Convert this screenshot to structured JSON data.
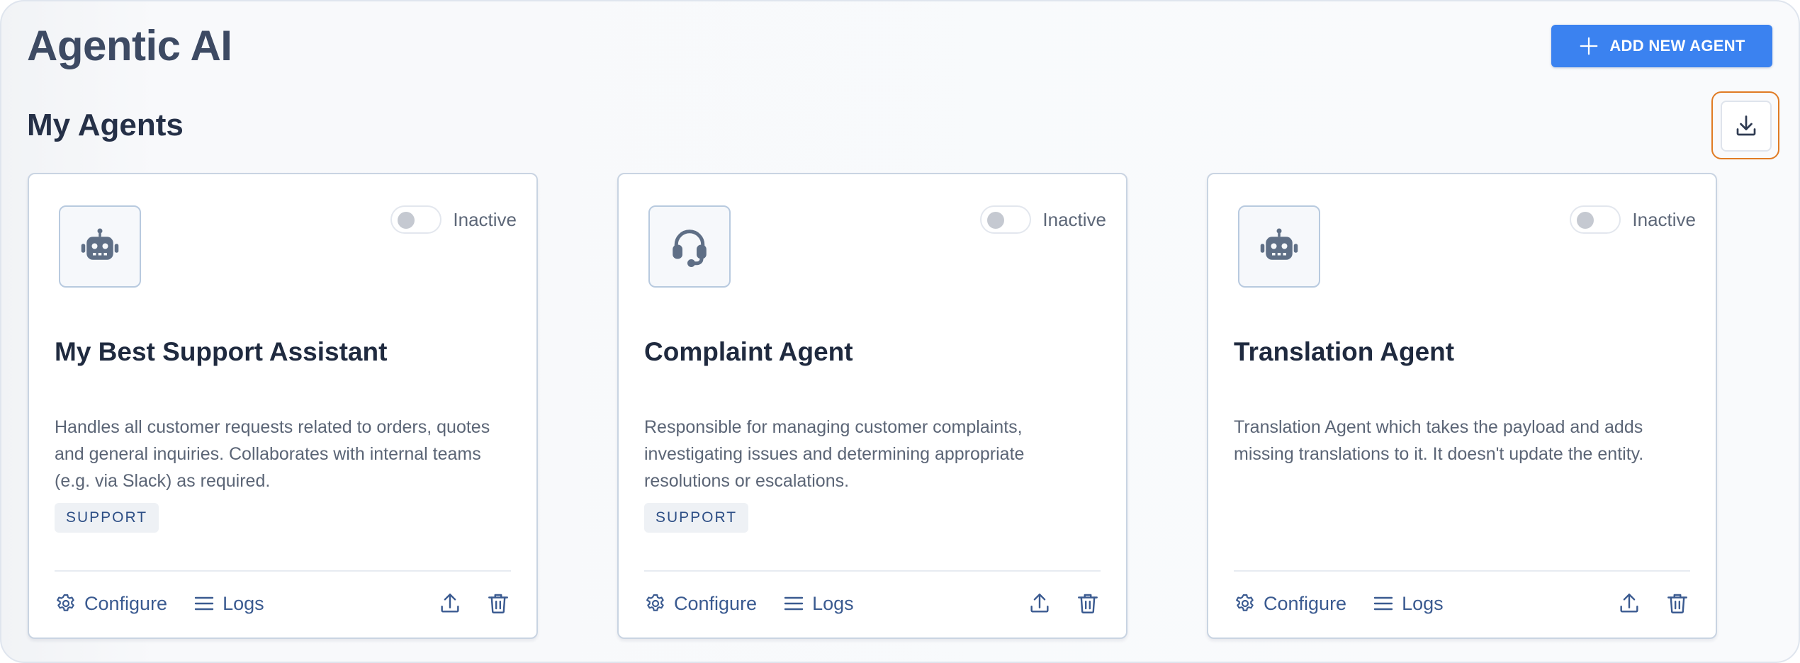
{
  "header": {
    "title": "Agentic AI",
    "add_button_label": "ADD NEW AGENT",
    "add_icon": "plus-icon",
    "import_icon": "download-icon"
  },
  "section": {
    "title": "My Agents"
  },
  "colors": {
    "accent": "#3b82f0",
    "focus_ring": "#e07b24",
    "link": "#3a5a90"
  },
  "agents": [
    {
      "icon": "robot-icon",
      "status_label": "Inactive",
      "active": false,
      "title": "My Best Support Assistant",
      "description": "Handles all customer requests related to orders, quotes and general inquiries. Collaborates with internal teams (e.g. via Slack) as required.",
      "tag": "SUPPORT",
      "configure_label": "Configure",
      "logs_label": "Logs"
    },
    {
      "icon": "headset-icon",
      "status_label": "Inactive",
      "active": false,
      "title": "Complaint Agent",
      "description": "Responsible for managing customer complaints, investigating issues and determining appropriate resolutions or escalations.",
      "tag": "SUPPORT",
      "configure_label": "Configure",
      "logs_label": "Logs"
    },
    {
      "icon": "robot-icon",
      "status_label": "Inactive",
      "active": false,
      "title": "Translation Agent",
      "description": "Translation Agent which takes the payload and adds missing translations to it. It doesn't update the entity.",
      "tag": "",
      "configure_label": "Configure",
      "logs_label": "Logs"
    }
  ]
}
